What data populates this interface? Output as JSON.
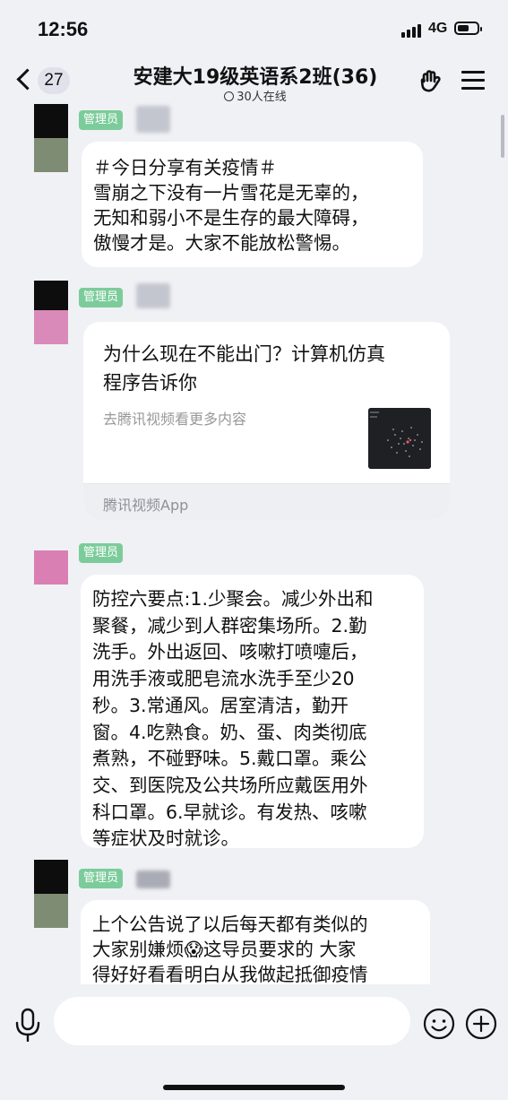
{
  "status_bar": {
    "time": "12:56",
    "network": "4G"
  },
  "header": {
    "back_count": "27",
    "title": "安建大19级英语系2班(36)",
    "subtitle": "30人在线"
  },
  "messages": [
    {
      "badge": "管理员",
      "text": "＃今日分享有关疫情＃\n雪崩之下没有一片雪花是无辜的，\n无知和弱小不是生存的最大障碍，\n傲慢才是。大家不能放松警惕。"
    },
    {
      "badge": "管理员",
      "card": {
        "title": "为什么现在不能出门？计算机仿真\n程序告诉你",
        "description": "去腾讯视频看更多内容",
        "source": "腾讯视频App"
      }
    },
    {
      "badge": "管理员",
      "text": "防控六要点:1.少聚会。减少外出和\n聚餐，减少到人群密集场所。2.勤\n洗手。外出返回、咳嗽打喷嚏后，\n用洗手液或肥皂流水洗手至少20\n秒。3.常通风。居室清洁，勤开\n窗。4.吃熟食。奶、蛋、肉类彻底\n煮熟，不碰野味。5.戴口罩。乘公\n交、到医院及公共场所应戴医用外\n科口罩。6.早就诊。有发热、咳嗽\n等症状及时就诊。"
    },
    {
      "badge": "管理员",
      "text": "上个公告说了以后每天都有类似的\n大家别嫌烦😱这导员要求的 大家\n得好好看看明白从我做起抵御疫情"
    }
  ],
  "input": {
    "placeholder": ""
  },
  "colors": {
    "badge": "#7ccc9b",
    "background": "#f0f1f5",
    "bubble": "#ffffff"
  },
  "icons": [
    "back-chevron-icon",
    "clock-icon",
    "raised-hand-icon",
    "menu-icon",
    "microphone-icon",
    "emoji-icon",
    "plus-icon"
  ]
}
